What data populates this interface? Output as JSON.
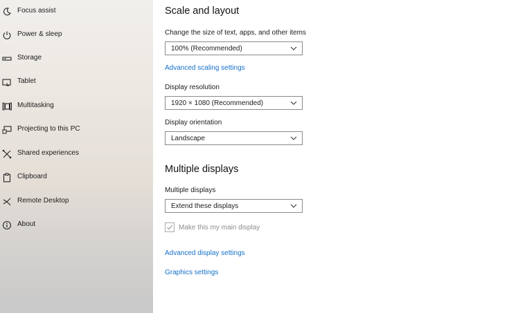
{
  "sidebar": {
    "items": [
      {
        "label": "Focus assist",
        "icon": "moon-icon"
      },
      {
        "label": "Power & sleep",
        "icon": "power-icon"
      },
      {
        "label": "Storage",
        "icon": "storage-icon"
      },
      {
        "label": "Tablet",
        "icon": "tablet-icon"
      },
      {
        "label": "Multitasking",
        "icon": "multitasking-icon"
      },
      {
        "label": "Projecting to this PC",
        "icon": "projecting-icon"
      },
      {
        "label": "Shared experiences",
        "icon": "shared-experiences-icon"
      },
      {
        "label": "Clipboard",
        "icon": "clipboard-icon"
      },
      {
        "label": "Remote Desktop",
        "icon": "remote-desktop-icon"
      },
      {
        "label": "About",
        "icon": "info-icon"
      }
    ]
  },
  "scale_layout": {
    "heading": "Scale and layout",
    "size_label": "Change the size of text, apps, and other items",
    "size_value": "100% (Recommended)",
    "advanced_scaling_link": "Advanced scaling settings",
    "resolution_label": "Display resolution",
    "resolution_value": "1920 × 1080 (Recommended)",
    "orientation_label": "Display orientation",
    "orientation_value": "Landscape"
  },
  "multiple_displays": {
    "heading": "Multiple displays",
    "label": "Multiple displays",
    "value": "Extend these displays",
    "main_display_checkbox_label": "Make this my main display",
    "main_display_checked": true,
    "main_display_enabled": false,
    "advanced_display_link": "Advanced display settings",
    "graphics_link": "Graphics settings"
  },
  "colors": {
    "link": "#1470c9",
    "sidebar_bg_top": "#f1efec",
    "sidebar_bg_bottom": "#c9c9c9",
    "disabled_text": "#8c8c8c"
  }
}
